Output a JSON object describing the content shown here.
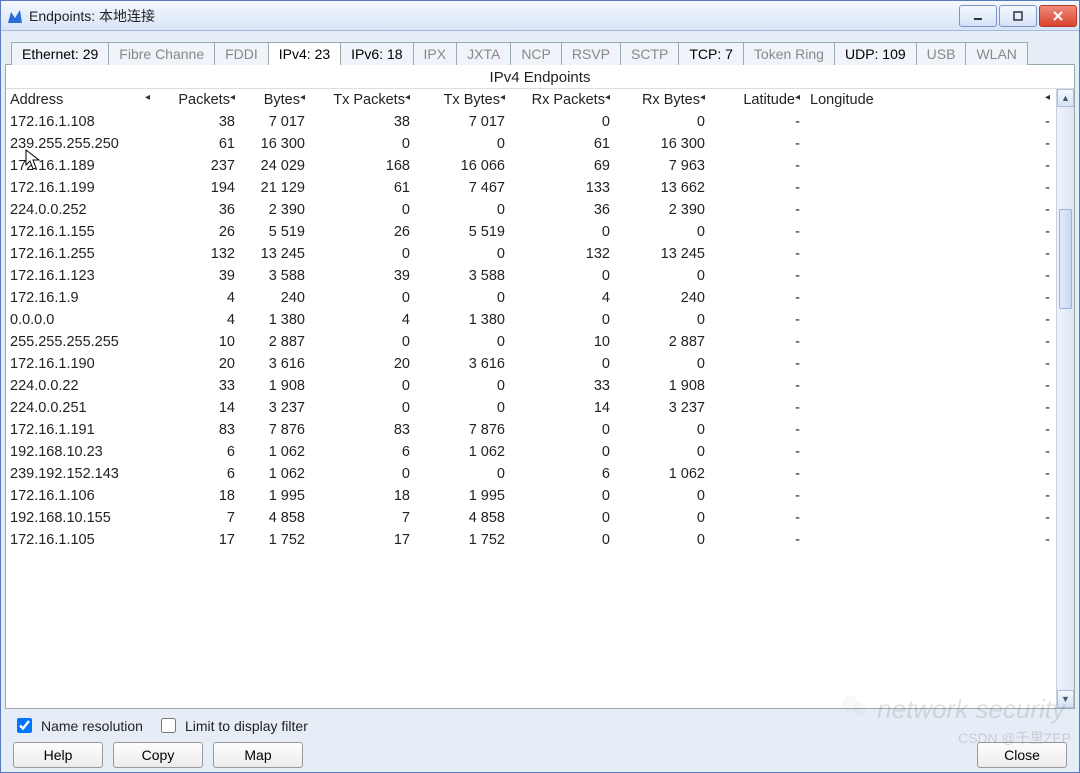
{
  "window": {
    "title": "Endpoints: 本地连接"
  },
  "tabs": [
    {
      "label": "Ethernet: 29",
      "enabled": true,
      "active": false
    },
    {
      "label": "Fibre Channe",
      "enabled": false,
      "active": false
    },
    {
      "label": "FDDI",
      "enabled": false,
      "active": false
    },
    {
      "label": "IPv4: 23",
      "enabled": true,
      "active": true
    },
    {
      "label": "IPv6: 18",
      "enabled": true,
      "active": false
    },
    {
      "label": "IPX",
      "enabled": false,
      "active": false
    },
    {
      "label": "JXTA",
      "enabled": false,
      "active": false
    },
    {
      "label": "NCP",
      "enabled": false,
      "active": false
    },
    {
      "label": "RSVP",
      "enabled": false,
      "active": false
    },
    {
      "label": "SCTP",
      "enabled": false,
      "active": false
    },
    {
      "label": "TCP: 7",
      "enabled": true,
      "active": false
    },
    {
      "label": "Token Ring",
      "enabled": false,
      "active": false
    },
    {
      "label": "UDP: 109",
      "enabled": true,
      "active": false
    },
    {
      "label": "USB",
      "enabled": false,
      "active": false
    },
    {
      "label": "WLAN",
      "enabled": false,
      "active": false
    }
  ],
  "panel": {
    "title": "IPv4 Endpoints"
  },
  "columns": {
    "address": "Address",
    "packets": "Packets",
    "bytes": "Bytes",
    "txp": "Tx Packets",
    "txb": "Tx Bytes",
    "rxp": "Rx Packets",
    "rxb": "Rx Bytes",
    "lat": "Latitude",
    "lon": "Longitude"
  },
  "rows": [
    {
      "address": "172.16.1.108",
      "packets": "38",
      "bytes": "7 017",
      "txp": "38",
      "txb": "7 017",
      "rxp": "0",
      "rxb": "0",
      "lat": "-",
      "lon": "-"
    },
    {
      "address": "239.255.255.250",
      "packets": "61",
      "bytes": "16 300",
      "txp": "0",
      "txb": "0",
      "rxp": "61",
      "rxb": "16 300",
      "lat": "-",
      "lon": "-"
    },
    {
      "address": "172.16.1.189",
      "packets": "237",
      "bytes": "24 029",
      "txp": "168",
      "txb": "16 066",
      "rxp": "69",
      "rxb": "7 963",
      "lat": "-",
      "lon": "-"
    },
    {
      "address": "172.16.1.199",
      "packets": "194",
      "bytes": "21 129",
      "txp": "61",
      "txb": "7 467",
      "rxp": "133",
      "rxb": "13 662",
      "lat": "-",
      "lon": "-"
    },
    {
      "address": "224.0.0.252",
      "packets": "36",
      "bytes": "2 390",
      "txp": "0",
      "txb": "0",
      "rxp": "36",
      "rxb": "2 390",
      "lat": "-",
      "lon": "-"
    },
    {
      "address": "172.16.1.155",
      "packets": "26",
      "bytes": "5 519",
      "txp": "26",
      "txb": "5 519",
      "rxp": "0",
      "rxb": "0",
      "lat": "-",
      "lon": "-"
    },
    {
      "address": "172.16.1.255",
      "packets": "132",
      "bytes": "13 245",
      "txp": "0",
      "txb": "0",
      "rxp": "132",
      "rxb": "13 245",
      "lat": "-",
      "lon": "-"
    },
    {
      "address": "172.16.1.123",
      "packets": "39",
      "bytes": "3 588",
      "txp": "39",
      "txb": "3 588",
      "rxp": "0",
      "rxb": "0",
      "lat": "-",
      "lon": "-"
    },
    {
      "address": "172.16.1.9",
      "packets": "4",
      "bytes": "240",
      "txp": "0",
      "txb": "0",
      "rxp": "4",
      "rxb": "240",
      "lat": "-",
      "lon": "-"
    },
    {
      "address": "0.0.0.0",
      "packets": "4",
      "bytes": "1 380",
      "txp": "4",
      "txb": "1 380",
      "rxp": "0",
      "rxb": "0",
      "lat": "-",
      "lon": "-"
    },
    {
      "address": "255.255.255.255",
      "packets": "10",
      "bytes": "2 887",
      "txp": "0",
      "txb": "0",
      "rxp": "10",
      "rxb": "2 887",
      "lat": "-",
      "lon": "-"
    },
    {
      "address": "172.16.1.190",
      "packets": "20",
      "bytes": "3 616",
      "txp": "20",
      "txb": "3 616",
      "rxp": "0",
      "rxb": "0",
      "lat": "-",
      "lon": "-"
    },
    {
      "address": "224.0.0.22",
      "packets": "33",
      "bytes": "1 908",
      "txp": "0",
      "txb": "0",
      "rxp": "33",
      "rxb": "1 908",
      "lat": "-",
      "lon": "-"
    },
    {
      "address": "224.0.0.251",
      "packets": "14",
      "bytes": "3 237",
      "txp": "0",
      "txb": "0",
      "rxp": "14",
      "rxb": "3 237",
      "lat": "-",
      "lon": "-"
    },
    {
      "address": "172.16.1.191",
      "packets": "83",
      "bytes": "7 876",
      "txp": "83",
      "txb": "7 876",
      "rxp": "0",
      "rxb": "0",
      "lat": "-",
      "lon": "-"
    },
    {
      "address": "192.168.10.23",
      "packets": "6",
      "bytes": "1 062",
      "txp": "6",
      "txb": "1 062",
      "rxp": "0",
      "rxb": "0",
      "lat": "-",
      "lon": "-"
    },
    {
      "address": "239.192.152.143",
      "packets": "6",
      "bytes": "1 062",
      "txp": "0",
      "txb": "0",
      "rxp": "6",
      "rxb": "1 062",
      "lat": "-",
      "lon": "-"
    },
    {
      "address": "172.16.1.106",
      "packets": "18",
      "bytes": "1 995",
      "txp": "18",
      "txb": "1 995",
      "rxp": "0",
      "rxb": "0",
      "lat": "-",
      "lon": "-"
    },
    {
      "address": "192.168.10.155",
      "packets": "7",
      "bytes": "4 858",
      "txp": "7",
      "txb": "4 858",
      "rxp": "0",
      "rxb": "0",
      "lat": "-",
      "lon": "-"
    },
    {
      "address": "172.16.1.105",
      "packets": "17",
      "bytes": "1 752",
      "txp": "17",
      "txb": "1 752",
      "rxp": "0",
      "rxb": "0",
      "lat": "-",
      "lon": "-"
    }
  ],
  "options": {
    "name_resolution": {
      "label": "Name resolution",
      "checked": true
    },
    "limit_filter": {
      "label": "Limit to display filter",
      "checked": false
    }
  },
  "buttons": {
    "help": "Help",
    "copy": "Copy",
    "map": "Map",
    "close": "Close"
  },
  "watermark": {
    "main": "network security",
    "sub": "CSDN @千里ZEP"
  }
}
